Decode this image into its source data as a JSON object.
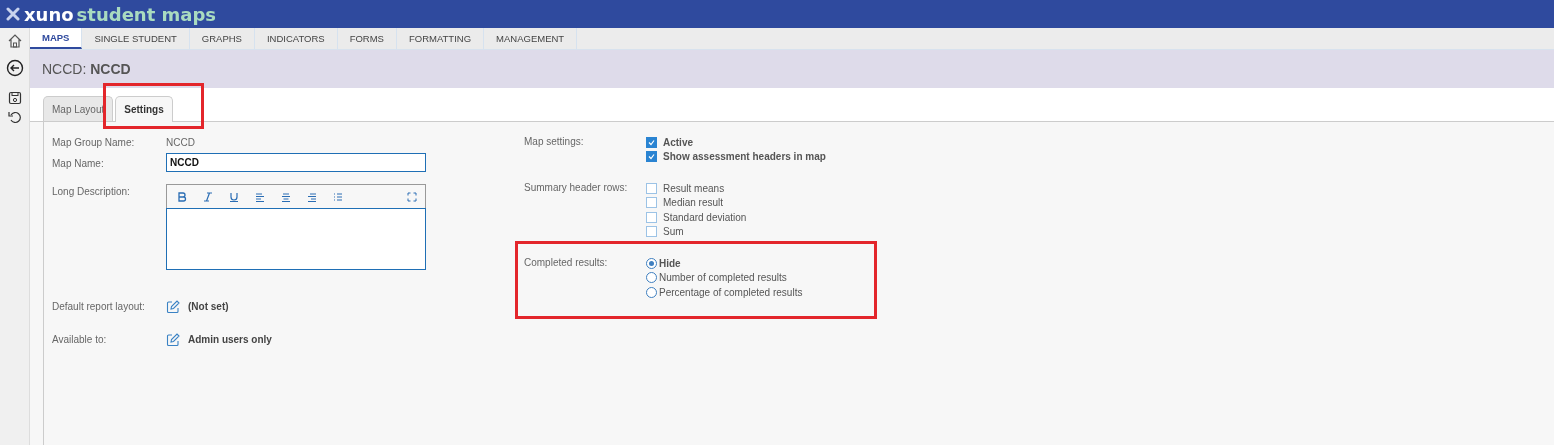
{
  "app": {
    "logo_text": "xuno",
    "product": "student maps"
  },
  "nav_tabs": [
    {
      "label": "MAPS",
      "selected": true
    },
    {
      "label": "SINGLE STUDENT",
      "selected": false
    },
    {
      "label": "GRAPHS",
      "selected": false
    },
    {
      "label": "INDICATORS",
      "selected": false
    },
    {
      "label": "FORMS",
      "selected": false
    },
    {
      "label": "FORMATTING",
      "selected": false
    },
    {
      "label": "MANAGEMENT",
      "selected": false
    }
  ],
  "page_title": {
    "prefix": "NCCD:",
    "name": "NCCD"
  },
  "sub_tabs": [
    {
      "label": "Map Layout",
      "selected": false,
      "highlighted": false
    },
    {
      "label": "Settings",
      "selected": true,
      "highlighted": true
    }
  ],
  "left_fields": [
    {
      "kind": "text",
      "label": "Map Group Name:",
      "value": "NCCD"
    },
    {
      "kind": "input",
      "label": "Map Name:",
      "value": "NCCD"
    },
    {
      "kind": "editor",
      "label": "Long Description:"
    },
    {
      "kind": "link",
      "label": "Default report layout:",
      "value": "(Not set)"
    },
    {
      "kind": "link",
      "label": "Available to:",
      "value": "Admin users only"
    }
  ],
  "right_sections": [
    {
      "kind": "checkbox",
      "label": "Map settings:",
      "highlighted": false,
      "options": [
        {
          "label": "Active",
          "checked": true
        },
        {
          "label": "Show assessment headers in map",
          "checked": true
        }
      ]
    },
    {
      "kind": "checkbox",
      "label": "Summary header rows:",
      "highlighted": false,
      "options": [
        {
          "label": "Result means",
          "checked": false
        },
        {
          "label": "Median result",
          "checked": false
        },
        {
          "label": "Standard deviation",
          "checked": false
        },
        {
          "label": "Sum",
          "checked": false
        }
      ]
    },
    {
      "kind": "radio",
      "label": "Completed results:",
      "highlighted": true,
      "options": [
        {
          "label": "Hide",
          "selected": true
        },
        {
          "label": "Number of completed results",
          "selected": false
        },
        {
          "label": "Percentage of completed results",
          "selected": false
        }
      ]
    }
  ]
}
